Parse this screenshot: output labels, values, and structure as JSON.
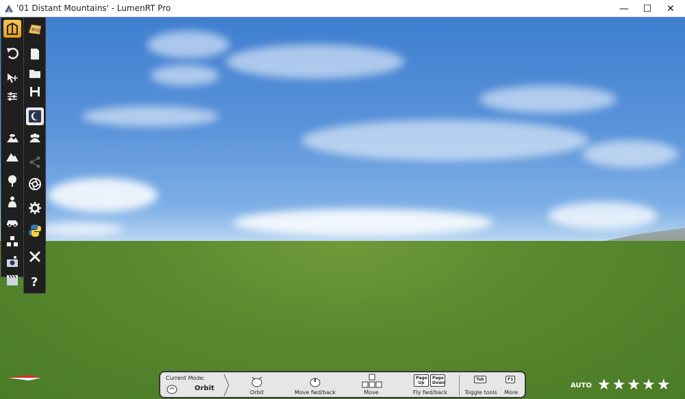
{
  "window": {
    "title": "'01 Distant Mountains' - LumenRT Pro",
    "minimize_glyph": "—",
    "maximize_glyph": "☐",
    "close_glyph": "✕"
  },
  "toolbar_left": {
    "items": [
      {
        "name": "scene-mode-icon",
        "active": true
      },
      {
        "name": "undo-icon"
      },
      {
        "name": "move-icon"
      },
      {
        "name": "adjust-sliders-icon"
      },
      {
        "name": "cloud-mountain-icon"
      },
      {
        "name": "mountain-icon"
      },
      {
        "name": "tree-icon"
      },
      {
        "name": "person-icon"
      },
      {
        "name": "car-icon"
      },
      {
        "name": "shapes-icon"
      },
      {
        "name": "camera-icon"
      },
      {
        "name": "clapper-icon"
      }
    ]
  },
  "toolbar_right": {
    "items": [
      {
        "name": "proj-logo-icon"
      },
      {
        "name": "new-file-icon"
      },
      {
        "name": "open-folder-icon"
      },
      {
        "name": "save-icon"
      },
      {
        "name": "night-mode-icon"
      },
      {
        "name": "people-icon"
      },
      {
        "name": "share-icon"
      },
      {
        "name": "aperture-icon"
      },
      {
        "name": "settings-gear-icon"
      },
      {
        "name": "python-icon"
      },
      {
        "name": "close-x-icon"
      },
      {
        "name": "help-icon"
      }
    ]
  },
  "help_bar": {
    "current_mode_label": "Current Mode:",
    "current_mode_value": "Orbit",
    "items": [
      {
        "label": "Orbit"
      },
      {
        "label": "Move fwd/back"
      },
      {
        "label": "Move"
      },
      {
        "label": "Fly fwd/back",
        "keys": [
          "Page Up",
          "Page Down"
        ]
      },
      {
        "label": "Toggle tools",
        "key": "Tab"
      },
      {
        "label": "More",
        "key": "F1"
      }
    ]
  },
  "quality": {
    "label": "AUTO",
    "stars": 5,
    "star_glyph": "★"
  },
  "colors": {
    "sky_top": "#3f7ed0",
    "grass": "#5a8a2f",
    "toolbar_bg": "#1f1f1f",
    "active_tool": "#f0b030"
  }
}
